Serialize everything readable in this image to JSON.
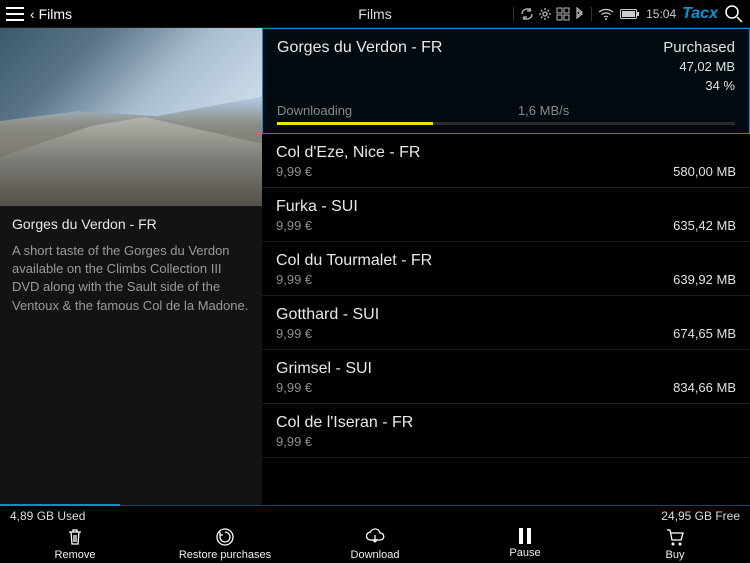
{
  "topbar": {
    "back_label": "Films",
    "title": "Films",
    "time": "15:04",
    "brand": "Tacx"
  },
  "detail": {
    "title": "Gorges du Verdon - FR",
    "description": "A short taste of the Gorges du Verdon available on the Climbs Collection III DVD along with the Sault side of the Ventoux & the famous Col de la Madone."
  },
  "films": [
    {
      "name": "Gorges du Verdon - FR",
      "status_label": "Purchased",
      "size": "47,02 MB",
      "download_status": "Downloading",
      "speed": "1,6 MB/s",
      "percent_label": "34 %",
      "progress_pct": 34,
      "selected": true
    },
    {
      "name": "Col d'Eze, Nice - FR",
      "price": "9,99 €",
      "size": "580,00 MB"
    },
    {
      "name": "Furka - SUI",
      "price": "9,99 €",
      "size": "635,42 MB"
    },
    {
      "name": "Col du Tourmalet - FR",
      "price": "9,99 €",
      "size": "639,92 MB"
    },
    {
      "name": "Gotthard - SUI",
      "price": "9,99 €",
      "size": "674,65 MB"
    },
    {
      "name": "Grimsel - SUI",
      "price": "9,99 €",
      "size": "834,66 MB"
    },
    {
      "name": "Col de l'Iseran - FR",
      "price": "9,99 €",
      "size": ""
    }
  ],
  "storage": {
    "used": "4,89 GB Used",
    "free": "24,95 GB Free",
    "used_pct": 16
  },
  "toolbar": {
    "remove": "Remove",
    "restore": "Restore purchases",
    "download": "Download",
    "pause": "Pause",
    "buy": "Buy"
  }
}
